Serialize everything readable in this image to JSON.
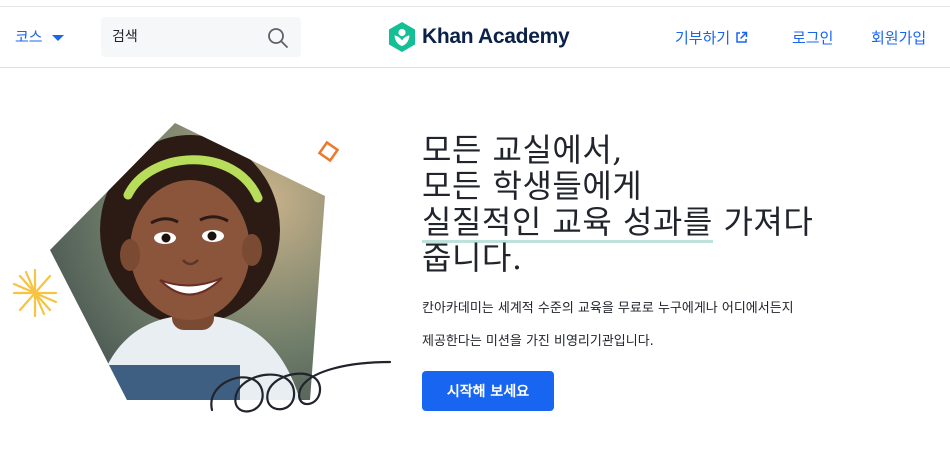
{
  "header": {
    "courses_label": "코스",
    "search_placeholder": "검색",
    "brand_name": "Khan Academy",
    "donate_label": "기부하기",
    "login_label": "로그인",
    "signup_label": "회원가입"
  },
  "hero": {
    "headline_1": "모든 교실에서,",
    "headline_2": "모든 학생들에게",
    "headline_3_highlight": "실질적인 교육 성과를",
    "headline_3_rest": " 가져다",
    "headline_4": "줍니다.",
    "description_1": "칸아카데미는 세계적 수준의 교육을 무료로 누구에게나 어디에서든지",
    "description_2": "제공한다는 미션을 가진 비영리기관입니다.",
    "cta_label": "시작해 보세요"
  },
  "colors": {
    "brand_blue": "#1865f2",
    "logo_green": "#14bf96",
    "headline_highlight": "#bfe3dc",
    "accent_orange": "#f0762b",
    "accent_yellow": "#f6c343"
  },
  "icons": {
    "caret": "chevron-down-icon",
    "search": "search-icon",
    "external": "external-link-icon",
    "logo": "khan-academy-logo"
  }
}
